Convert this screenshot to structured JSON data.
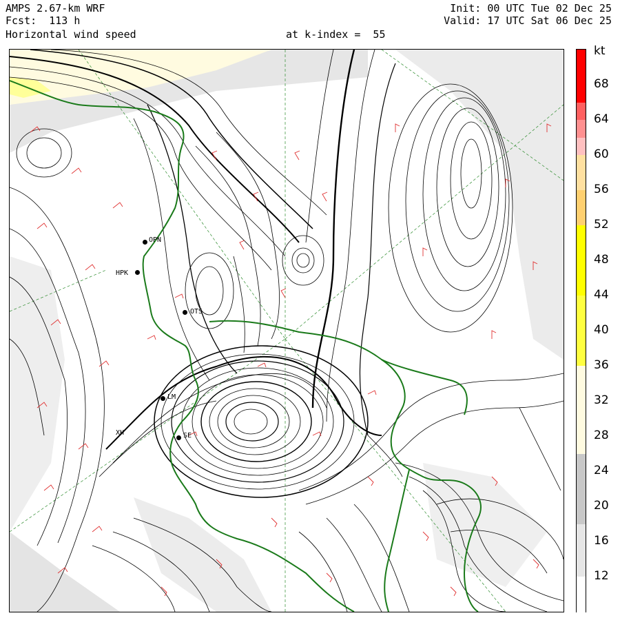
{
  "header": {
    "model": "AMPS 2.67-km WRF",
    "forecast": "Fcst:  113 h",
    "field": "Horizontal wind speed",
    "level": "at k-index =  55",
    "init": "Init: 00 UTC Tue 02 Dec 25",
    "valid": "Valid: 17 UTC Sat 06 Dec 25"
  },
  "colorbar": {
    "unit": "kt",
    "min": 8,
    "max": 72,
    "step": 2,
    "labels": [
      "68",
      "64",
      "60",
      "56",
      "52",
      "48",
      "44",
      "40",
      "36",
      "32",
      "28",
      "24",
      "20",
      "16",
      "12"
    ],
    "colors": {
      "white": "#ffffff",
      "light_gray": "#e6e6e6",
      "mid_gray": "#c8c8c8",
      "cream": "#fffbe0",
      "yellow": "#ffff00",
      "orange": "#ffd070",
      "pink": "#ffc0c0",
      "red": "#ff0000"
    }
  },
  "map": {
    "stations": [
      "OPN",
      "HPK",
      "OTS",
      "LM",
      "SE",
      "XH"
    ],
    "colors": {
      "contour": "#000000",
      "coastline": "#1a7a1a",
      "barb": "#e03030",
      "graticule": "#2a8a2a"
    }
  }
}
